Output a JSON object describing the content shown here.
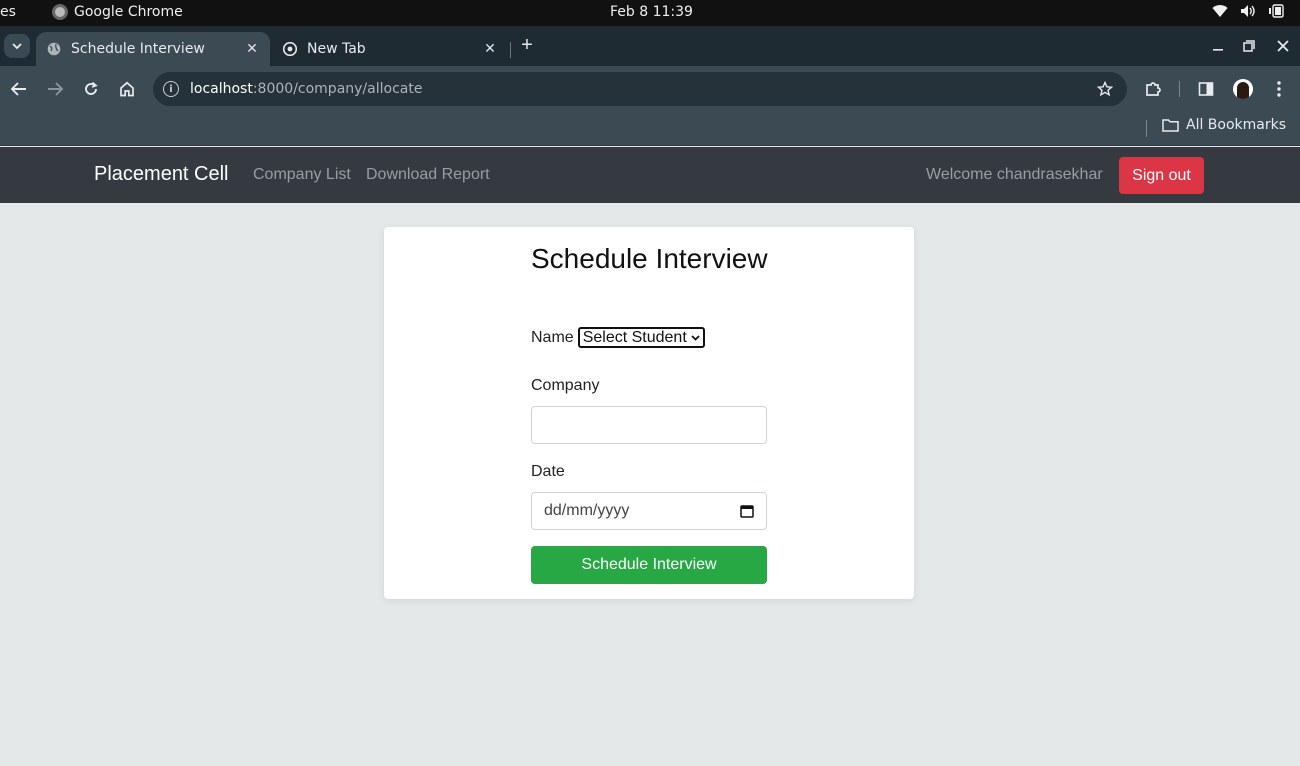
{
  "os": {
    "activities": "es",
    "app_name": "Google Chrome",
    "clock": "Feb 8  11:39"
  },
  "tabs": [
    {
      "title": "Schedule Interview",
      "active": true
    },
    {
      "title": "New Tab",
      "active": false
    }
  ],
  "toolbar": {
    "url_host": "localhost",
    "url_path": ":8000/company/allocate"
  },
  "bookmarks": {
    "all_label": "All Bookmarks"
  },
  "navbar": {
    "brand": "Placement Cell",
    "links": [
      "Company List",
      "Download Report"
    ],
    "welcome": "Welcome chandrasekhar",
    "signout": "Sign out"
  },
  "form": {
    "title": "Schedule Interview",
    "name_label": "Name",
    "name_select_value": "Select Student",
    "company_label": "Company",
    "company_value": "",
    "date_label": "Date",
    "date_placeholder": "dd/mm/yyyy",
    "submit_label": "Schedule Interview"
  },
  "colors": {
    "navbar_bg": "#343a40",
    "signout_bg": "#dc3545",
    "submit_bg": "#28a745",
    "page_bg": "#e4e8e9"
  }
}
